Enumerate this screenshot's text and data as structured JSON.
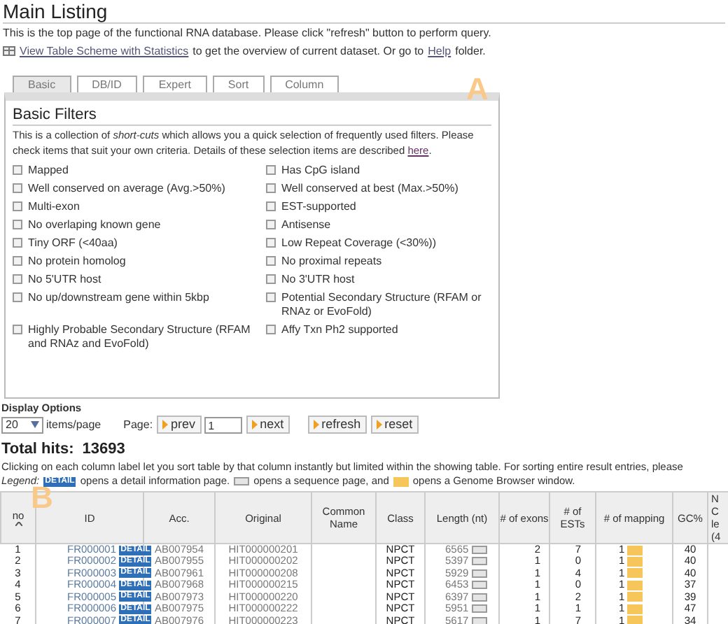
{
  "page_title": "Main Listing",
  "intro": {
    "text": "This is the top page of the functional RNA database. Please click \"refresh\" button to perform query.",
    "scheme_link": "View Table Scheme with Statistics",
    "after_link": "to get the overview of current dataset. Or go to",
    "help_link": "Help",
    "after_help": "folder."
  },
  "tabs": [
    {
      "label": "Basic",
      "selected": true
    },
    {
      "label": "DB/ID",
      "selected": false
    },
    {
      "label": "Expert",
      "selected": false
    },
    {
      "label": "Sort",
      "selected": false
    },
    {
      "label": "Column",
      "selected": false
    }
  ],
  "panel_labels": [
    "A",
    "B"
  ],
  "filters": {
    "title": "Basic Filters",
    "description": "This is a collection of *short-cuts* which allows you a quick selection of frequently used filters. Please check items that suit your own criteria. Details of these selection items are described",
    "here_link": "here",
    "end": ".",
    "items": [
      {
        "label": "Mapped",
        "checked": false
      },
      {
        "label": "Has CpG island",
        "checked": false
      },
      {
        "label": "Well conserved on average (Avg.>50%)",
        "checked": false
      },
      {
        "label": "Well conserved at best (Max.>50%)",
        "checked": false
      },
      {
        "label": "Multi-exon",
        "checked": false
      },
      {
        "label": "EST-supported",
        "checked": false
      },
      {
        "label": "No overlaping known gene",
        "checked": false
      },
      {
        "label": "Antisense",
        "checked": false
      },
      {
        "label": "Tiny ORF (<40aa)",
        "checked": false
      },
      {
        "label": "Low Repeat Coverage (<30%))",
        "checked": false
      },
      {
        "label": "No protein homolog",
        "checked": false
      },
      {
        "label": "No proximal repeats",
        "checked": false
      },
      {
        "label": "No 5'UTR host",
        "checked": false
      },
      {
        "label": "No 3'UTR host",
        "checked": false
      },
      {
        "label": "No up/downstream gene within 5kbp",
        "checked": false
      },
      {
        "label": "Potential Secondary Structure (RFAM or RNAz or EvoFold)",
        "checked": false
      },
      {
        "label": "Highly Probable Secondary Structure (RFAM and RNAz and EvoFold)",
        "checked": false
      },
      {
        "label": "Affy Txn Ph2 supported",
        "checked": false
      }
    ]
  },
  "display_options": {
    "title": "Display Options",
    "items_per_page": "20",
    "items_label": "items/page",
    "page_label": "Page:",
    "prev": "prev",
    "page": "1",
    "next": "next",
    "refresh": "refresh",
    "reset": "reset"
  },
  "total_hits": {
    "label": "Total hits:",
    "value": "13693"
  },
  "sort_note": "Clicking on each column label let you sort table by that column instantly but limited within the showing table. For sorting entire result entries, please",
  "legend": {
    "label": "Legend:",
    "detail_badge": "DETAIL",
    "detail_text": "opens a detail information page.",
    "seq_text": "opens a sequence page, and",
    "genome_text": "opens a Genome Browser window."
  },
  "table": {
    "columns": [
      "no",
      "ID",
      "Acc.",
      "Original",
      "Common Name",
      "Class",
      "Length (nt)",
      "# of exons",
      "# of ESTs",
      "# of mapping",
      "GC%",
      "N C le (4"
    ],
    "rows": [
      {
        "no": "1",
        "id": "FR000001",
        "badge": "DETAIL",
        "acc": "AB007954",
        "original": "HIT000000201",
        "class": "NPCT",
        "length": "6565",
        "exons": "2",
        "ests": "7",
        "mapping": "1",
        "gc": "40"
      },
      {
        "no": "2",
        "id": "FR000002",
        "badge": "DETAIL",
        "acc": "AB007955",
        "original": "HIT000000202",
        "class": "NPCT",
        "length": "5397",
        "exons": "1",
        "ests": "0",
        "mapping": "1",
        "gc": "40"
      },
      {
        "no": "3",
        "id": "FR000003",
        "badge": "DETAIL",
        "acc": "AB007961",
        "original": "HIT000000208",
        "class": "NPCT",
        "length": "5929",
        "exons": "1",
        "ests": "4",
        "mapping": "1",
        "gc": "40"
      },
      {
        "no": "4",
        "id": "FR000004",
        "badge": "DETAIL",
        "acc": "AB007968",
        "original": "HIT000000215",
        "class": "NPCT",
        "length": "6453",
        "exons": "1",
        "ests": "0",
        "mapping": "1",
        "gc": "37"
      },
      {
        "no": "5",
        "id": "FR000005",
        "badge": "DETAIL",
        "acc": "AB007973",
        "original": "HIT000000220",
        "class": "NPCT",
        "length": "6397",
        "exons": "1",
        "ests": "2",
        "mapping": "1",
        "gc": "39"
      },
      {
        "no": "6",
        "id": "FR000006",
        "badge": "DETAIL",
        "acc": "AB007975",
        "original": "HIT000000222",
        "class": "NPCT",
        "length": "5951",
        "exons": "1",
        "ests": "1",
        "mapping": "1",
        "gc": "47"
      },
      {
        "no": "7",
        "id": "FR000007",
        "badge": "DETAIL",
        "acc": "AB007976",
        "original": "HIT000000223",
        "class": "NPCT",
        "length": "5617",
        "exons": "1",
        "ests": "7",
        "mapping": "1",
        "gc": "34"
      }
    ]
  }
}
